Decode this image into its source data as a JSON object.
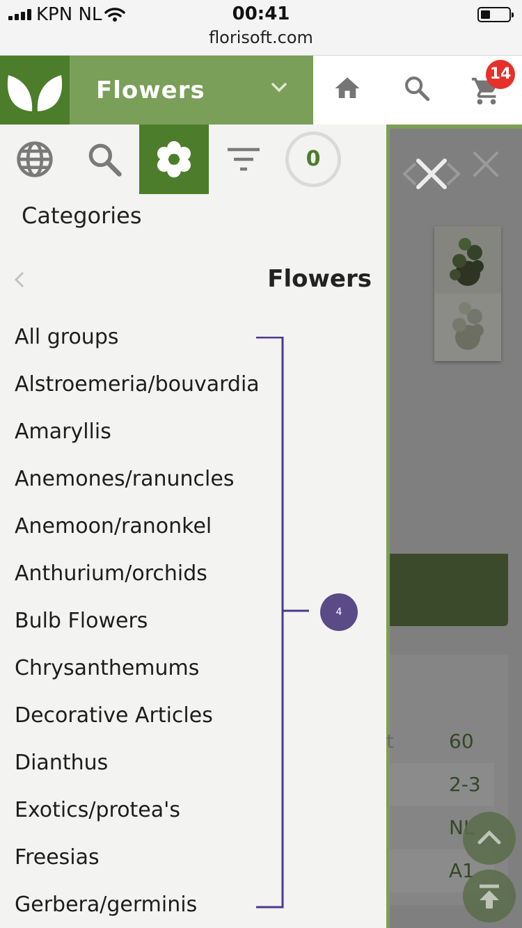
{
  "status_bar": {
    "carrier": "KPN NL",
    "time": "00:41",
    "url": "florisoft.com"
  },
  "header": {
    "category_label": "Flowers",
    "cart_count": "14",
    "brand_color": "#4c7d2b",
    "icons": [
      "leaf-logo-icon",
      "chevron-down-icon",
      "home-icon",
      "search-icon",
      "cart-icon"
    ]
  },
  "toolbar": {
    "icons": [
      "globe-icon",
      "search-icon",
      "flower-icon",
      "filter-icon"
    ],
    "active": "flower-icon",
    "selection_count": "0"
  },
  "drawer": {
    "heading": "Categories",
    "current": "Flowers",
    "items": [
      "All groups",
      "Alstroemeria/bouvardia",
      "Amaryllis",
      "Anemones/ranuncles",
      "Anemoon/ranonkel",
      "Anthurium/orchids",
      "Bulb Flowers",
      "Chrysanthemums",
      "Decorative Articles",
      "Dianthus",
      "Exotics/protea's",
      "Freesias",
      "Gerbera/germinis"
    ]
  },
  "annotation": {
    "badge": "4",
    "color": "#4b3a8c"
  },
  "background_page": {
    "values": [
      "60",
      "2-3",
      "NL",
      "A1"
    ],
    "partial_text": "t"
  }
}
